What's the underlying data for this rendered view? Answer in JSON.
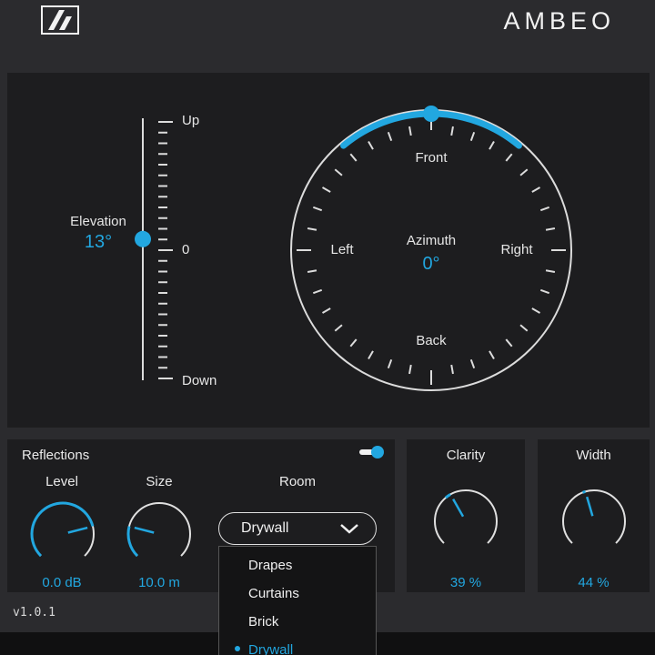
{
  "header": {
    "brand": "AMBEO",
    "logo_icon": "sennheiser-logo-icon"
  },
  "elevation": {
    "label": "Elevation",
    "value_text": "13°",
    "value": 13,
    "range": [
      -90,
      90
    ],
    "scale_up": "Up",
    "scale_zero": "0",
    "scale_down": "Down"
  },
  "azimuth": {
    "label": "Azimuth",
    "value_text": "0°",
    "value": 0,
    "front": "Front",
    "back": "Back",
    "left": "Left",
    "right": "Right"
  },
  "reflections": {
    "title": "Reflections",
    "enabled": true,
    "level": {
      "label": "Level",
      "value_text": "0.0 dB"
    },
    "size": {
      "label": "Size",
      "value_text": "10.0 m"
    },
    "room": {
      "label": "Room",
      "selected": "Drywall",
      "options": [
        "Drapes",
        "Curtains",
        "Brick",
        "Drywall"
      ]
    }
  },
  "clarity": {
    "title": "Clarity",
    "value_text": "39 %",
    "value": 39
  },
  "width": {
    "title": "Width",
    "value_text": "44 %",
    "value": 44
  },
  "footer": {
    "version": "v1.0.1"
  },
  "colors": {
    "accent": "#22a7e0",
    "background": "#2b2b2e",
    "panel": "#1d1d1f"
  }
}
